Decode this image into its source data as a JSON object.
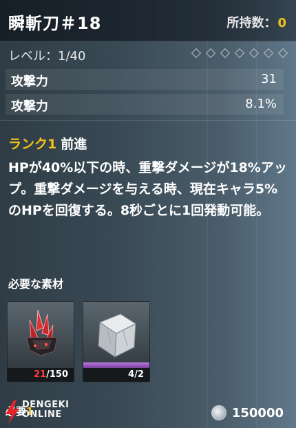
{
  "header": {
    "weapon_name": "瞬斬刀＃18",
    "owned_label": "所持数：",
    "owned_count": "0"
  },
  "level": {
    "text": "レベル：1/40",
    "max_diamonds": 7
  },
  "stats": [
    {
      "label": "攻撃力",
      "value": "31"
    },
    {
      "label": "攻撃力",
      "value": "8.1%"
    }
  ],
  "skill": {
    "rank": "ランク1",
    "name": "前進",
    "description": "HPが40%以下の時、重撃ダメージが18%アップ。重撃ダメージを与える時、現在キャラ5%のHPを回復する。8秒ごとに1回発動可能。"
  },
  "materials": {
    "title": "必要な素材",
    "items": [
      {
        "icon": "red-crystal-shard-icon",
        "have": "21",
        "need": "/150"
      },
      {
        "icon": "silver-cube-icon",
        "have": "4",
        "need": "/2"
      }
    ]
  },
  "footer": {
    "left_label": "必要",
    "left_value": "1",
    "coin_icon": "coin-icon",
    "coin_value": "150000"
  },
  "watermark": {
    "line1": "DENGEKI",
    "line2": "ONLINE"
  },
  "colors": {
    "accent_yellow": "#f5c21b",
    "insufficient_red": "#ff3b3b",
    "rarity_purple": "#9a5cc4"
  }
}
